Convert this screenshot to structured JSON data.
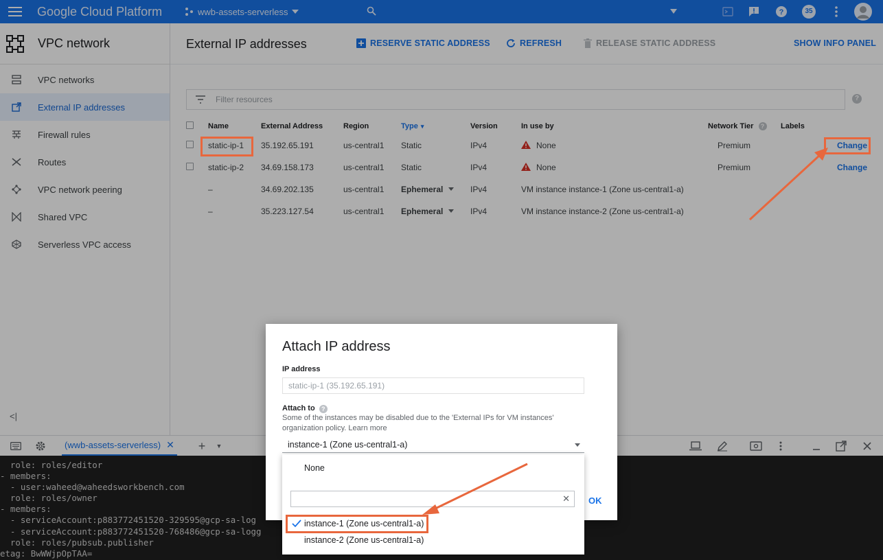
{
  "topbar": {
    "brand": "Google Cloud Platform",
    "project": "wwb-assets-serverless",
    "notifications_count": "35"
  },
  "sidebar": {
    "title": "VPC network",
    "items": [
      {
        "label": "VPC networks",
        "icon": "vpc-networks-icon"
      },
      {
        "label": "External IP addresses",
        "icon": "external-ip-icon"
      },
      {
        "label": "Firewall rules",
        "icon": "firewall-icon"
      },
      {
        "label": "Routes",
        "icon": "routes-icon"
      },
      {
        "label": "VPC network peering",
        "icon": "peering-icon"
      },
      {
        "label": "Shared VPC",
        "icon": "shared-vpc-icon"
      },
      {
        "label": "Serverless VPC access",
        "icon": "serverless-icon"
      }
    ],
    "active_index": 1,
    "collapse": "<|"
  },
  "main": {
    "title": "External IP addresses",
    "actions": {
      "reserve": "RESERVE STATIC ADDRESS",
      "refresh": "REFRESH",
      "release": "RELEASE STATIC ADDRESS",
      "info": "SHOW INFO PANEL"
    },
    "filter_placeholder": "Filter resources",
    "columns": [
      "Name",
      "External Address",
      "Region",
      "Type",
      "Version",
      "In use by",
      "Network Tier",
      "Labels"
    ],
    "rows": [
      {
        "name": "static-ip-1",
        "address": "35.192.65.191",
        "region": "us-central1",
        "type": "Static",
        "version": "IPv4",
        "in_use": "None",
        "tier": "Premium",
        "action": "Change"
      },
      {
        "name": "static-ip-2",
        "address": "34.69.158.173",
        "region": "us-central1",
        "type": "Static",
        "version": "IPv4",
        "in_use": "None",
        "tier": "Premium",
        "action": "Change"
      },
      {
        "name": "–",
        "address": "34.69.202.135",
        "region": "us-central1",
        "type": "Ephemeral",
        "version": "IPv4",
        "in_use_prefix": "VM instance ",
        "in_use_instance": "instance-1",
        "in_use_suffix": " (Zone us-central1-a)"
      },
      {
        "name": "–",
        "address": "35.223.127.54",
        "region": "us-central1",
        "type": "Ephemeral",
        "version": "IPv4",
        "in_use_prefix": "VM instance ",
        "in_use_instance": "instance-2",
        "in_use_suffix": " (Zone us-central1-a)"
      }
    ]
  },
  "shell": {
    "tab": "(wwb-assets-serverless)",
    "lines": [
      "  role: roles/editor",
      "- members:",
      "  - user:waheed@waheedsworkbench.com",
      "  role: roles/owner",
      "- members:",
      "  - serviceAccount:p883772451520-329595@gcp-sa-log",
      "  - serviceAccount:p883772451520-768486@gcp-sa-logg",
      "  role: roles/pubsub.publisher",
      "etag: BwWWjpOpTAA="
    ]
  },
  "dialog": {
    "title": "Attach IP address",
    "ip_label": "IP address",
    "ip_value": "static-ip-1 (35.192.65.191)",
    "attach_label": "Attach to",
    "hint": "Some of the instances may be disabled due to the 'External IPs for VM instances' organization policy.",
    "learn_more": "Learn more",
    "selected": "instance-1 (Zone us-central1-a)",
    "ok": "OK",
    "options": {
      "none": "None",
      "opt1": "instance-1 (Zone us-central1-a)",
      "opt2": "instance-2 (Zone us-central1-a)"
    }
  },
  "colors": {
    "brand_blue": "#1a73e8",
    "highlight": "#e8673d",
    "terminal_bg": "#1f1f1f",
    "warning": "#d93025"
  }
}
